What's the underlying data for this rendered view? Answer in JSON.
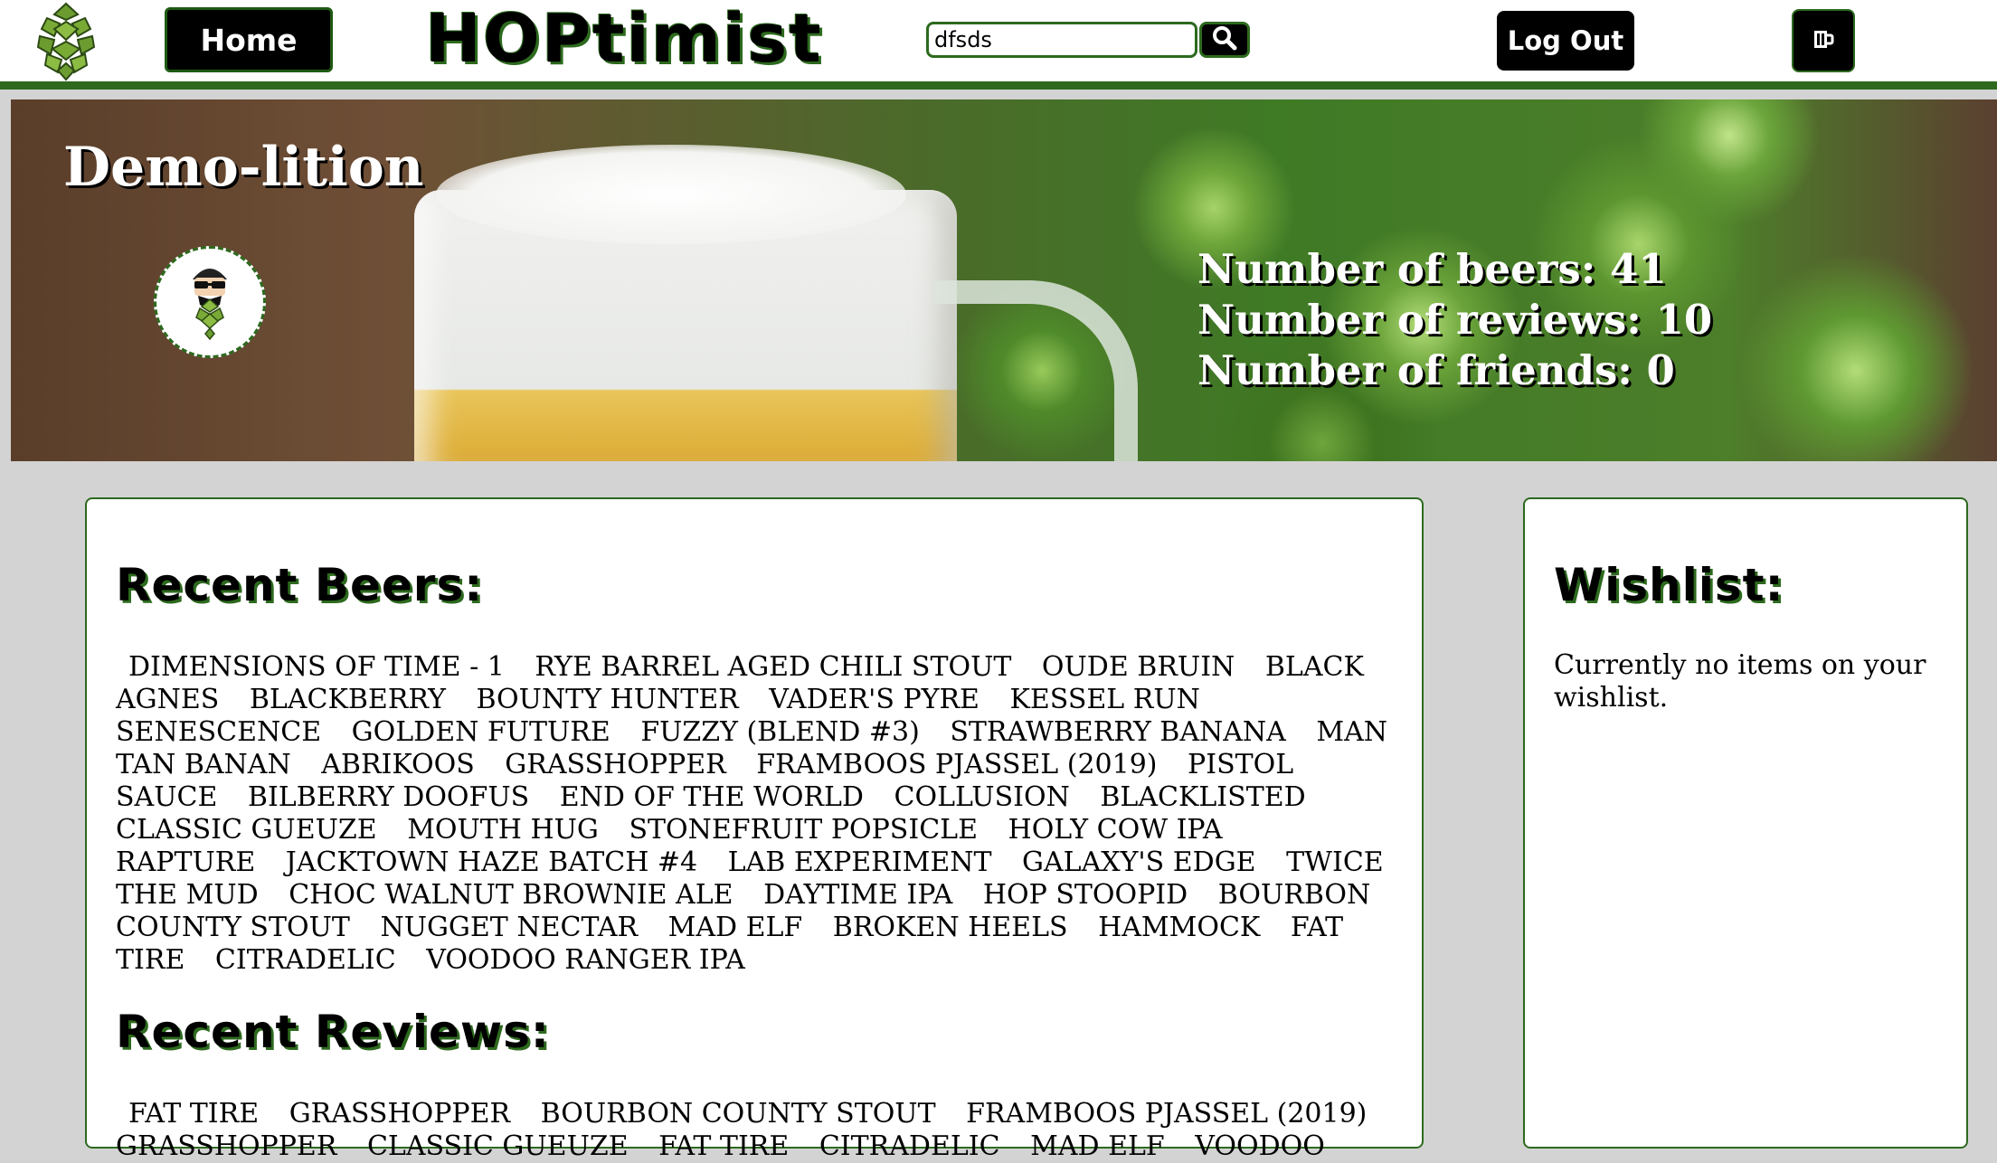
{
  "header": {
    "home_label": "Home",
    "brand": "HOPtimist",
    "search_value": "dfsds",
    "logout_label": "Log Out",
    "icons": {
      "logo": "hop-cone-icon",
      "search": "search-icon",
      "mug": "beer-mug-icon"
    }
  },
  "profile": {
    "name": "Demo-lition",
    "stats": {
      "beers": "Number of beers: 41",
      "reviews": "Number of reviews: 10",
      "friends": "Number of friends: 0"
    }
  },
  "recent_beers": {
    "heading": "Recent Beers:",
    "items": [
      "Dimensions of Time - 1",
      "Rye Barrel Aged Chili Stout",
      "Oude Bruin",
      "Black Agnes",
      "Blackberry",
      "Bounty Hunter",
      "Vader's Pyre",
      "Kessel Run",
      "Senescence",
      "Golden Future",
      "Fuzzy (Blend #3)",
      "Strawberry Banana",
      "Man Tan Banan",
      "Abrikoos",
      "Grasshopper",
      "Framboos Pjassel (2019)",
      "Pistol Sauce",
      "Bilberry Doofus",
      "End of the World",
      "Collusion",
      "Blacklisted",
      "Classic Gueuze",
      "Mouth Hug",
      "Stonefruit Popsicle",
      "Holy Cow IPA",
      "Rapture",
      "Jacktown Haze Batch #4",
      "Lab Experiment",
      "Galaxy's Edge",
      "Twice the Mud",
      "Choc Walnut Brownie Ale",
      "Daytime IPA",
      "Hop Stoopid",
      "Bourbon County Stout",
      "Nugget Nectar",
      "Mad Elf",
      "Broken Heels",
      "Hammock",
      "Fat Tire",
      "Citradelic",
      "Voodoo Ranger IPA"
    ]
  },
  "recent_reviews": {
    "heading": "Recent Reviews:",
    "items": [
      "Fat Tire",
      "Grasshopper",
      "Bourbon County Stout",
      "Framboos Pjassel (2019)",
      "Grasshopper",
      "Classic Gueuze",
      "Fat Tire",
      "Citradelic",
      "Mad Elf",
      "Voodoo"
    ]
  },
  "wishlist": {
    "heading": "Wishlist:",
    "empty_text": "Currently no items on your wishlist."
  },
  "colors": {
    "accent": "#2d6a1e",
    "background": "#d3d3d3",
    "button": "#000000"
  }
}
